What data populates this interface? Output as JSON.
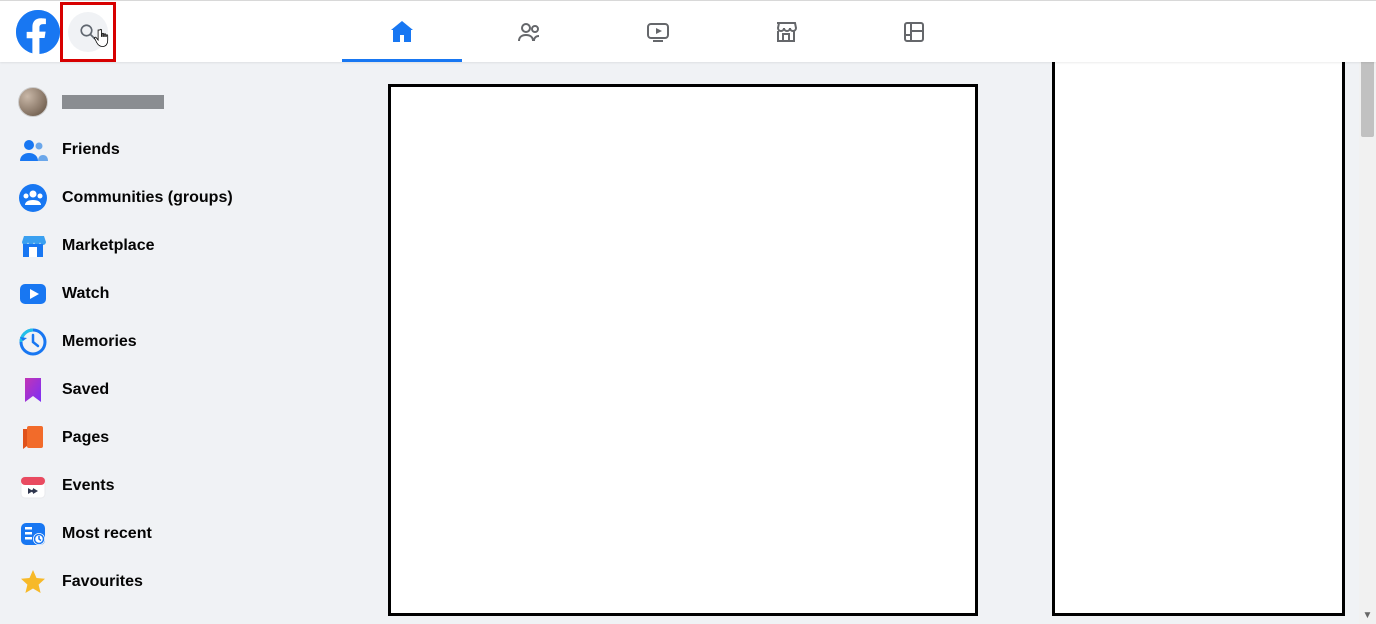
{
  "header": {
    "logo_letter": "f"
  },
  "nav": {
    "items": [
      "home",
      "friends",
      "watch",
      "marketplace",
      "gaming"
    ],
    "active_index": 0
  },
  "sidebar": {
    "items": [
      {
        "label": "Friends",
        "icon": "friends"
      },
      {
        "label": "Communities (groups)",
        "icon": "groups"
      },
      {
        "label": "Marketplace",
        "icon": "marketplace"
      },
      {
        "label": "Watch",
        "icon": "watch"
      },
      {
        "label": "Memories",
        "icon": "memories"
      },
      {
        "label": "Saved",
        "icon": "saved"
      },
      {
        "label": "Pages",
        "icon": "pages"
      },
      {
        "label": "Events",
        "icon": "events"
      },
      {
        "label": "Most recent",
        "icon": "recent"
      },
      {
        "label": "Favourites",
        "icon": "favourites"
      }
    ]
  },
  "colors": {
    "brand": "#1877f2",
    "highlight": "#d70000"
  }
}
